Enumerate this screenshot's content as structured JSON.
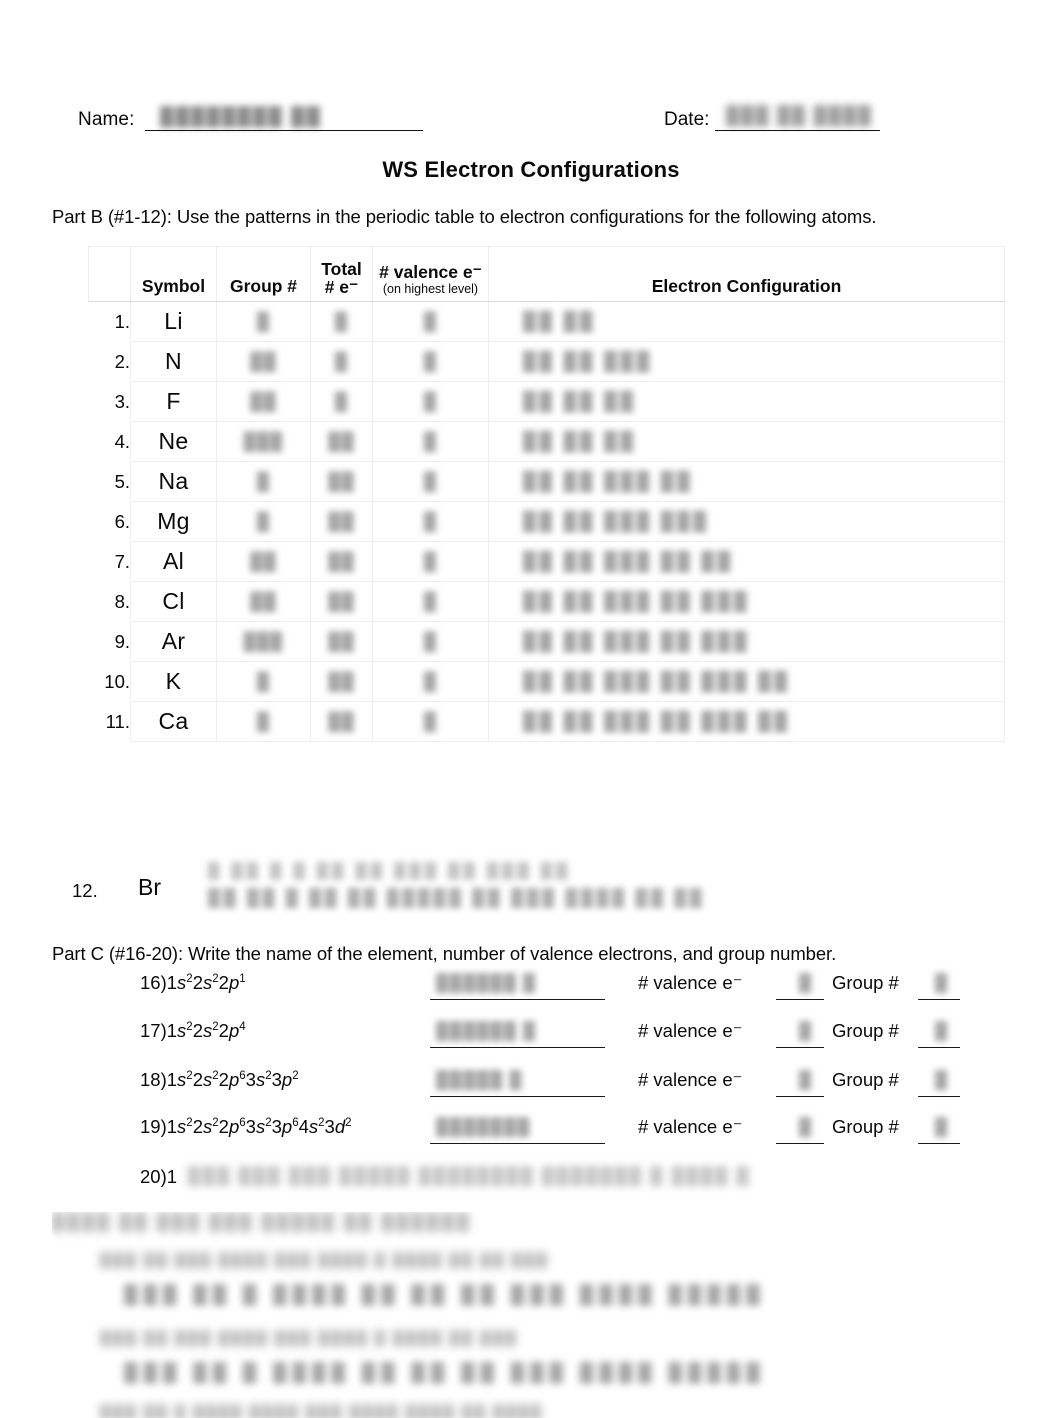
{
  "header": {
    "name_label": "Name:",
    "date_label": "Date:",
    "name_value_redacted": "████████ ██",
    "date_value_redacted": "███ ██ ████"
  },
  "title": "WS Electron Configurations",
  "part_b": {
    "instruction": "Part B (#1-12): Use the patterns in the periodic table to electron configurations for the following atoms.",
    "columns": {
      "number": "",
      "symbol": "Symbol",
      "group": "Group #",
      "total_e_line1": "Total",
      "total_e_line2": "# e⁻",
      "valence_line1": "# valence e⁻",
      "valence_line2": "(on highest level)",
      "configuration": "Electron Configuration"
    },
    "rows": [
      {
        "num": "1.",
        "symbol": "Li",
        "group": "█",
        "total": "█",
        "valence": "█",
        "config": "██ ██"
      },
      {
        "num": "2.",
        "symbol": "N",
        "group": "██",
        "total": "█",
        "valence": "█",
        "config": "██ ██ ███"
      },
      {
        "num": "3.",
        "symbol": "F",
        "group": "██",
        "total": "█",
        "valence": "█",
        "config": "██ ██ ██"
      },
      {
        "num": "4.",
        "symbol": "Ne",
        "group": "███",
        "total": "██",
        "valence": "█",
        "config": "██ ██ ██"
      },
      {
        "num": "5.",
        "symbol": "Na",
        "group": "█",
        "total": "██",
        "valence": "█",
        "config": "██ ██ ███ ██"
      },
      {
        "num": "6.",
        "symbol": "Mg",
        "group": "█",
        "total": "██",
        "valence": "█",
        "config": "██ ██ ███ ███"
      },
      {
        "num": "7.",
        "symbol": "Al",
        "group": "██",
        "total": "██",
        "valence": "█",
        "config": "██ ██ ███ ██ ██"
      },
      {
        "num": "8.",
        "symbol": "Cl",
        "group": "██",
        "total": "██",
        "valence": "█",
        "config": "██ ██ ███ ██ ███"
      },
      {
        "num": "9.",
        "symbol": "Ar",
        "group": "███",
        "total": "██",
        "valence": "█",
        "config": "██ ██ ███ ██ ███"
      },
      {
        "num": "10.",
        "symbol": "K",
        "group": "█",
        "total": "██",
        "valence": "█",
        "config": "██ ██ ███ ██ ███ ██"
      },
      {
        "num": "11.",
        "symbol": "Ca",
        "group": "█",
        "total": "██",
        "valence": "█",
        "config": "██ ██ ███ ██ ███ ██"
      }
    ],
    "row12": {
      "num": "12.",
      "symbol": "Br",
      "ghost_top": "█  ██  █  █   ██ ██ ███ ██ ███ ██",
      "ghost_mid": "██  ██  █   ██ ██ █████ ██ ███ ████ ██ ██"
    }
  },
  "part_c": {
    "instruction": "Part C (#16-20):  Write the name of the element, number of valence electrons, and group number.",
    "valence_label": "# valence e⁻",
    "group_label": "Group #",
    "items": [
      {
        "number": "16)",
        "config_plain": "1s²2s²2p¹",
        "config_parts": [
          {
            "n": "1",
            "orb": "s",
            "sup": "2"
          },
          {
            "n": "2",
            "orb": "s",
            "sup": "2"
          },
          {
            "n": "2",
            "orb": "p",
            "sup": "1"
          }
        ],
        "answer_name": "██████ █",
        "answer_valence": "█",
        "answer_group": "█"
      },
      {
        "number": "17)",
        "config_plain": "1s²2s²2p⁴",
        "config_parts": [
          {
            "n": "1",
            "orb": "s",
            "sup": "2"
          },
          {
            "n": "2",
            "orb": "s",
            "sup": "2"
          },
          {
            "n": "2",
            "orb": "p",
            "sup": "4"
          }
        ],
        "answer_name": "██████ █",
        "answer_valence": "█",
        "answer_group": "█"
      },
      {
        "number": "18)",
        "config_plain": "1s²2s²2p⁶3s²3p²",
        "config_parts": [
          {
            "n": "1",
            "orb": "s",
            "sup": "2"
          },
          {
            "n": "2",
            "orb": "s",
            "sup": "2"
          },
          {
            "n": "2",
            "orb": "p",
            "sup": "6"
          },
          {
            "n": "3",
            "orb": "s",
            "sup": "2"
          },
          {
            "n": "3",
            "orb": "p",
            "sup": "2"
          }
        ],
        "answer_name": "█████ █",
        "answer_valence": "█",
        "answer_group": "█"
      },
      {
        "number": "19)",
        "config_plain": "1s²2s²2p⁶3s²3p⁶4s²3d²",
        "config_parts": [
          {
            "n": "1",
            "orb": "s",
            "sup": "2"
          },
          {
            "n": "2",
            "orb": "s",
            "sup": "2"
          },
          {
            "n": "2",
            "orb": "p",
            "sup": "6"
          },
          {
            "n": "3",
            "orb": "s",
            "sup": "2"
          },
          {
            "n": "3",
            "orb": "p",
            "sup": "6"
          },
          {
            "n": "4",
            "orb": "s",
            "sup": "2"
          },
          {
            "n": "3",
            "orb": "d",
            "sup": "2"
          }
        ],
        "answer_name": "███████",
        "answer_valence": "█",
        "answer_group": "█"
      }
    ],
    "item20": {
      "number": "20)1",
      "redacted_rest": "███ ███ ███ █████  ████████ ███████  █  ████ █"
    }
  },
  "bottom_redacted": {
    "heading": "████  ██ ███ ███ █████ ██ ██████",
    "q1": "███ ██ ███ ████ ███ ████ █ ████      ██ ██ ███",
    "a1": "███ ██  █  ████ ██  ██ ██ ███  ████ █████",
    "q2": "███ ██ ███ ████ ███ ████ █ ████     ██ ███",
    "a2": "███ ██  █ ████ ██  ██ ██ ███  ████ █████",
    "q3": "███ ██ █ ████ ████ ███ ████ ████ ██ ████"
  }
}
